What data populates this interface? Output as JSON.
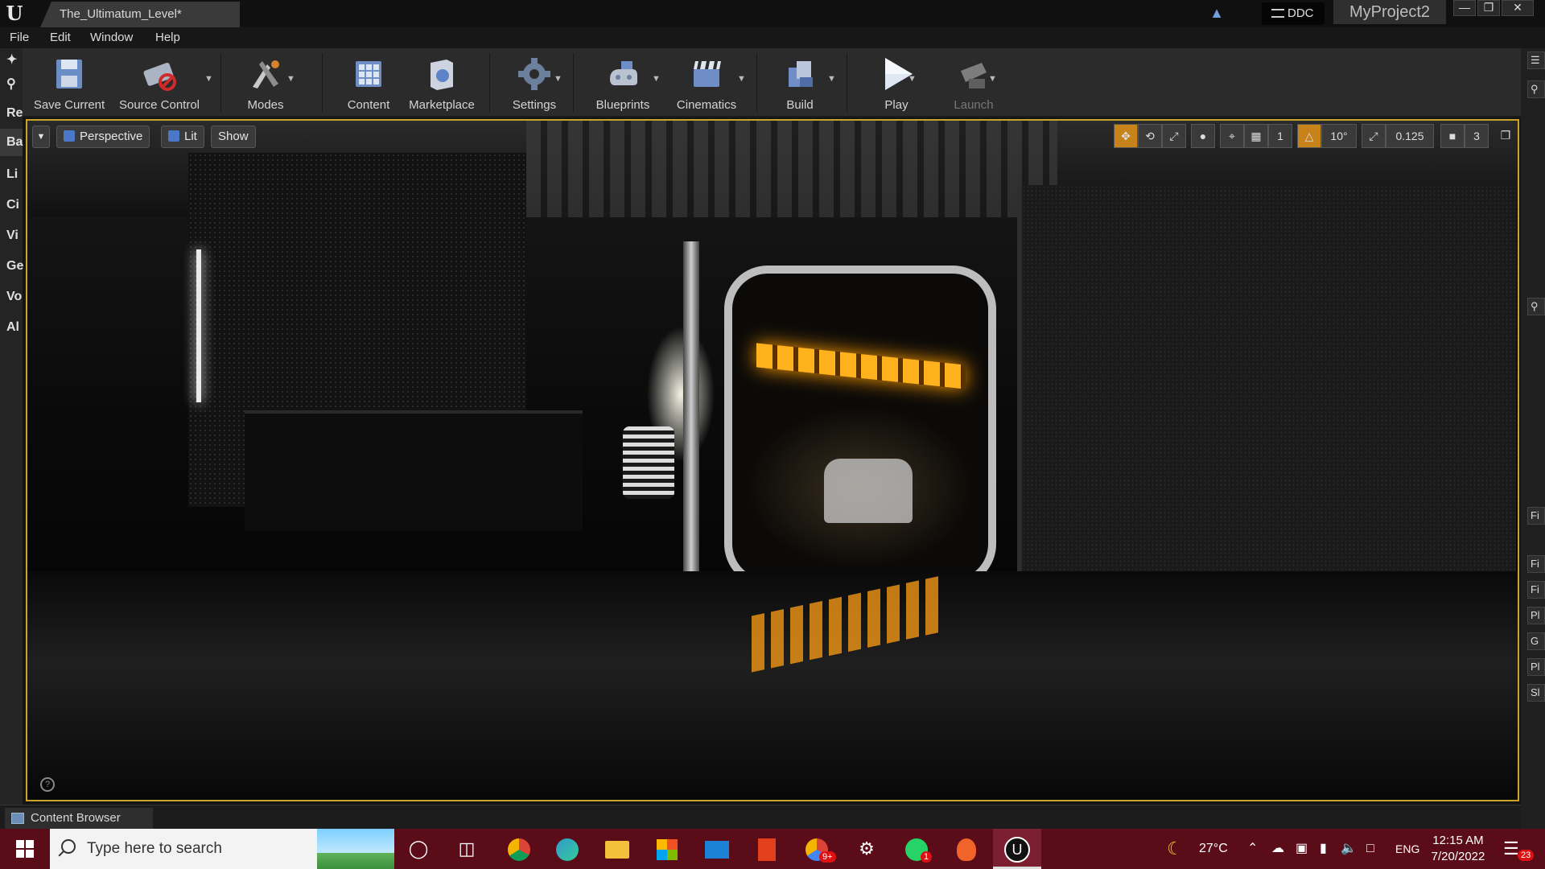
{
  "titlebar": {
    "tab_label": "The_Ultimatum_Level*",
    "ddc_label": "DDC",
    "project_name": "MyProject2",
    "logo": "U"
  },
  "menu": [
    "File",
    "Edit",
    "Window",
    "Help"
  ],
  "left_panel": [
    "Re",
    "Ba",
    "Li",
    "Ci",
    "Vi",
    "Ge",
    "Vo",
    "Al"
  ],
  "toolbar": {
    "buttons": [
      {
        "label": "Save Current",
        "icon": "save-icon"
      },
      {
        "label": "Source Control",
        "icon": "source-control-icon"
      },
      {
        "label": "Modes",
        "icon": "modes-icon"
      },
      {
        "label": "Content",
        "icon": "content-icon"
      },
      {
        "label": "Marketplace",
        "icon": "marketplace-icon"
      },
      {
        "label": "Settings",
        "icon": "settings-icon"
      },
      {
        "label": "Blueprints",
        "icon": "blueprints-icon"
      },
      {
        "label": "Cinematics",
        "icon": "cinematics-icon"
      },
      {
        "label": "Build",
        "icon": "build-icon"
      },
      {
        "label": "Play",
        "icon": "play-icon"
      },
      {
        "label": "Launch",
        "icon": "launch-icon"
      }
    ]
  },
  "viewport": {
    "perspective_label": "Perspective",
    "lit_label": "Lit",
    "show_label": "Show",
    "grid_size": "1",
    "rotation_snap": "10°",
    "scale_snap": "0.125",
    "camera_speed": "3"
  },
  "right_panel": [
    "Fi",
    "Fi",
    "Fi",
    "Pl",
    "G",
    "Pl",
    "Sl"
  ],
  "content_browser": {
    "tab_label": "Content Browser"
  },
  "taskbar": {
    "search_placeholder": "Type here to search",
    "temperature": "27°C",
    "language": "ENG",
    "time": "12:15 AM",
    "date": "7/20/2022",
    "notifications": "23",
    "whatsapp_badge": "1",
    "chrome_badge": "9+"
  },
  "colors": {
    "accent": "#c8a52a",
    "taskbar": "#5a0d18",
    "bg": "#151515"
  }
}
